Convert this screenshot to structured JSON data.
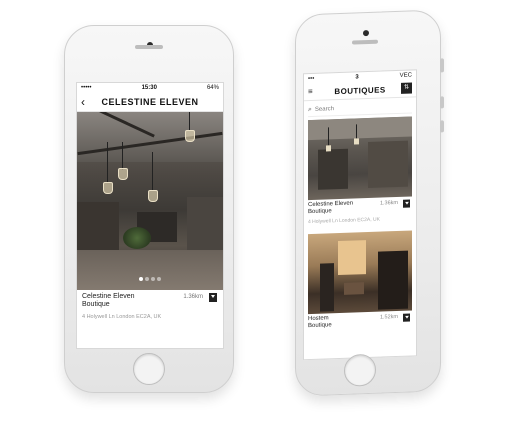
{
  "phone1": {
    "status": {
      "left": "•••••",
      "time": "15:30",
      "right": "64%"
    },
    "nav": {
      "back_icon": "‹",
      "title": "CELESTINE ELEVEN"
    },
    "boutique": {
      "name": "Celestine Eleven",
      "type": "Boutique",
      "distance": "1.36km",
      "address": "4 Holywell Ln London EC2A, UK"
    },
    "gallery": {
      "pages": 4,
      "active": 0
    }
  },
  "phone2": {
    "status": {
      "time": "3",
      "right": "VEC"
    },
    "nav": {
      "menu_icon": "≡",
      "title": "BOUTIQUES",
      "filter_icon": "⇅"
    },
    "search": {
      "placeholder": "Search"
    },
    "cards": [
      {
        "name": "Celestine Eleven",
        "type": "Boutique",
        "distance": "1.36km",
        "address": "4 Holywell Ln London EC2A, UK"
      },
      {
        "name": "Hostem",
        "type": "Boutique",
        "distance": "1.52km"
      }
    ]
  },
  "colors": {
    "accent": "#222222",
    "text": "#111111",
    "muted": "#999999"
  }
}
